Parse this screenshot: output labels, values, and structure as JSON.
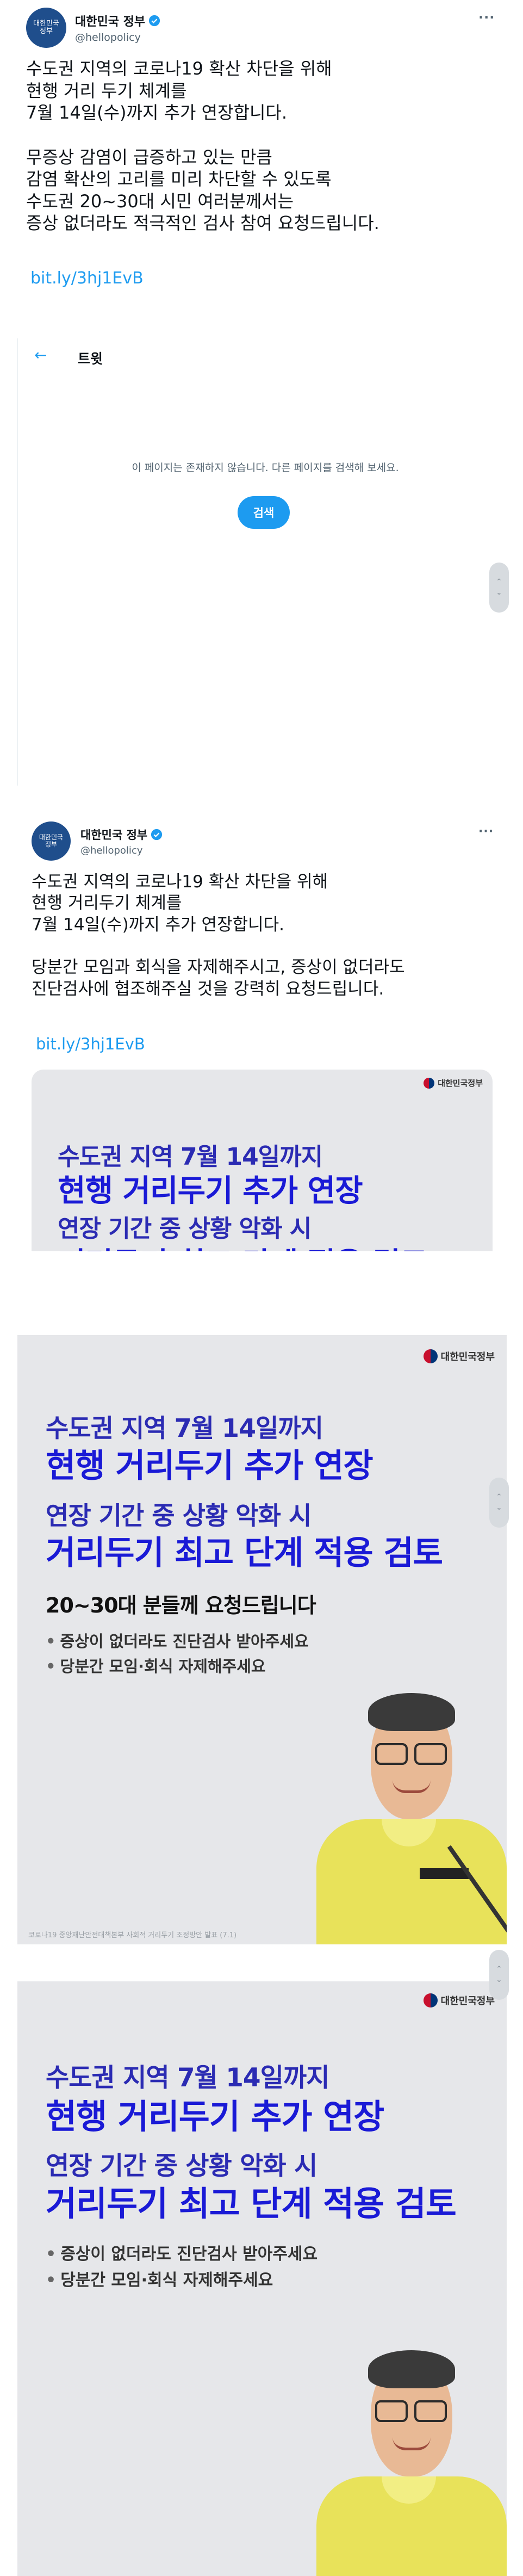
{
  "tweet1": {
    "avatar_lines": [
      "대한민국",
      "정부"
    ],
    "display_name": "대한민국 정부",
    "handle": "@hellopolicy",
    "more": "···",
    "text": "수도권 지역의 코로나19 확산 차단을 위해\n현행 거리 두기 체계를\n7월 14일(수)까지 추가 연장합니다.\n\n무증상 감염이 급증하고 있는 만큼\n감염 확산의 고리를 미리 차단할 수 있도록\n수도권 20~30대 시민 여러분께서는\n증상 없더라도 적극적인 검사 참여 요청드립니다.",
    "link": "bit.ly/3hj1EvB"
  },
  "error_embed": {
    "back_icon": "←",
    "title": "트윗",
    "message": "이 페이지는 존재하지 않습니다. 다른 페이지를 검색해 보세요.",
    "search_label": "검색"
  },
  "scroll_widget": {
    "up": "⌃",
    "down": "⌄"
  },
  "tweet2": {
    "avatar_lines": [
      "대한민국",
      "정부"
    ],
    "display_name": "대한민국 정부",
    "handle": "@hellopolicy",
    "more": "···",
    "text": "수도권 지역의 코로나19 확산 차단을 위해\n현행 거리두기 체계를\n7월 14일(수)까지 추가 연장합니다.\n\n당분간 모임과 회식을 자제해주시고, 증상이 없더라도\n진단검사에 협조해주실 것을 강력히 요청드립니다.",
    "link": "bit.ly/3hj1EvB"
  },
  "poster": {
    "logo_text": "대한민국정부",
    "line1": "수도권 지역 7월 14일까지",
    "line2": "현행 거리두기 추가 연장",
    "line3": "연장 기간 중 상황 악화 시",
    "line4": "거리두기 최고 단계 적용 검토",
    "line5": "20~30대 분들께 요청드립니다",
    "bullet1": "증상이 없더라도 진단검사 받아주세요",
    "bullet2": "당분간 모임·회식 자제해주세요",
    "footnote": "코로나19 중앙재난안전대책본부 사회적 거리두기 조정방안 발표 (7.1)"
  },
  "colors": {
    "twitter_blue": "#1d9bf0",
    "poster_bg": "#e6e7ea",
    "poster_blue": "#1a1ad6",
    "jacket_yellow": "#e8e25a",
    "gov_navy": "#1f4e8c"
  },
  "icons": [
    "verified-badge-icon",
    "more-options-icon",
    "back-arrow-icon",
    "chevron-up-icon",
    "chevron-down-icon",
    "taegeuk-logo-icon"
  ]
}
